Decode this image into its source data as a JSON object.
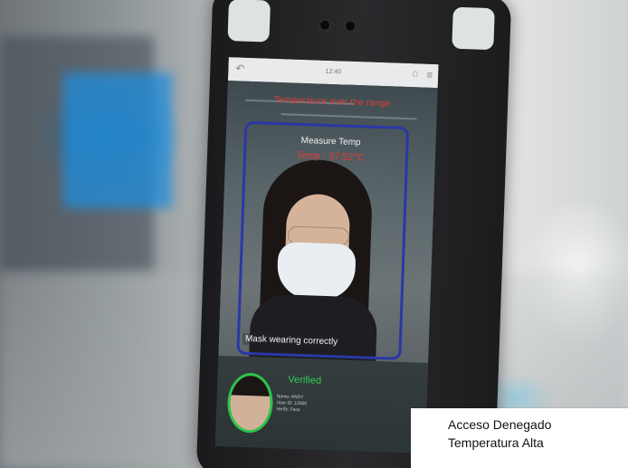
{
  "device_screen": {
    "status_time": "12:40",
    "warning": "Temperature over the range",
    "measure_title": "Measure Temp",
    "temperature_reading": "Temp : 37.52°C",
    "mask_status": "Mask wearing correctly",
    "verification": "Verified",
    "user_meta": [
      "Name: ANDY",
      "User ID: 10000",
      "Verify: Face"
    ]
  },
  "caption": {
    "line1": "Acceso Denegado",
    "line2": "Temperatura Alta"
  },
  "colors": {
    "warning_red": "#e23b3b",
    "face_box_blue": "#2a38a6",
    "verified_green": "#2fcf55"
  }
}
